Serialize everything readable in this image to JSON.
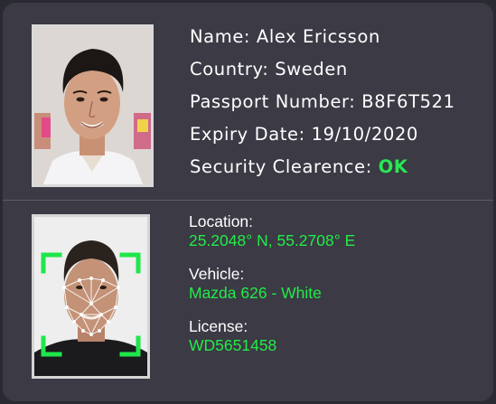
{
  "profile": {
    "name": "Name: Alex Ericsson",
    "country": "Country: Sweden",
    "passport": "Passport Number: B8F6T521",
    "expiry": "Expiry Date: 19/10/2020",
    "security_label": "Security Clearence:",
    "security_status": "OK"
  },
  "details": {
    "location_label": "Location:",
    "location_value": "25.2048° N, 55.2708° E",
    "vehicle_label": "Vehicle:",
    "vehicle_value": "Mazda 626 - White",
    "license_label": "License:",
    "license_value": "WD5651458"
  },
  "colors": {
    "panel": "#3b3a45",
    "status_ok": "#27e84f",
    "detail_value": "#22ec47",
    "scan_frame": "#1fe64a"
  },
  "icons": [
    "face-scan-frame-icon",
    "face-mesh-icon"
  ]
}
